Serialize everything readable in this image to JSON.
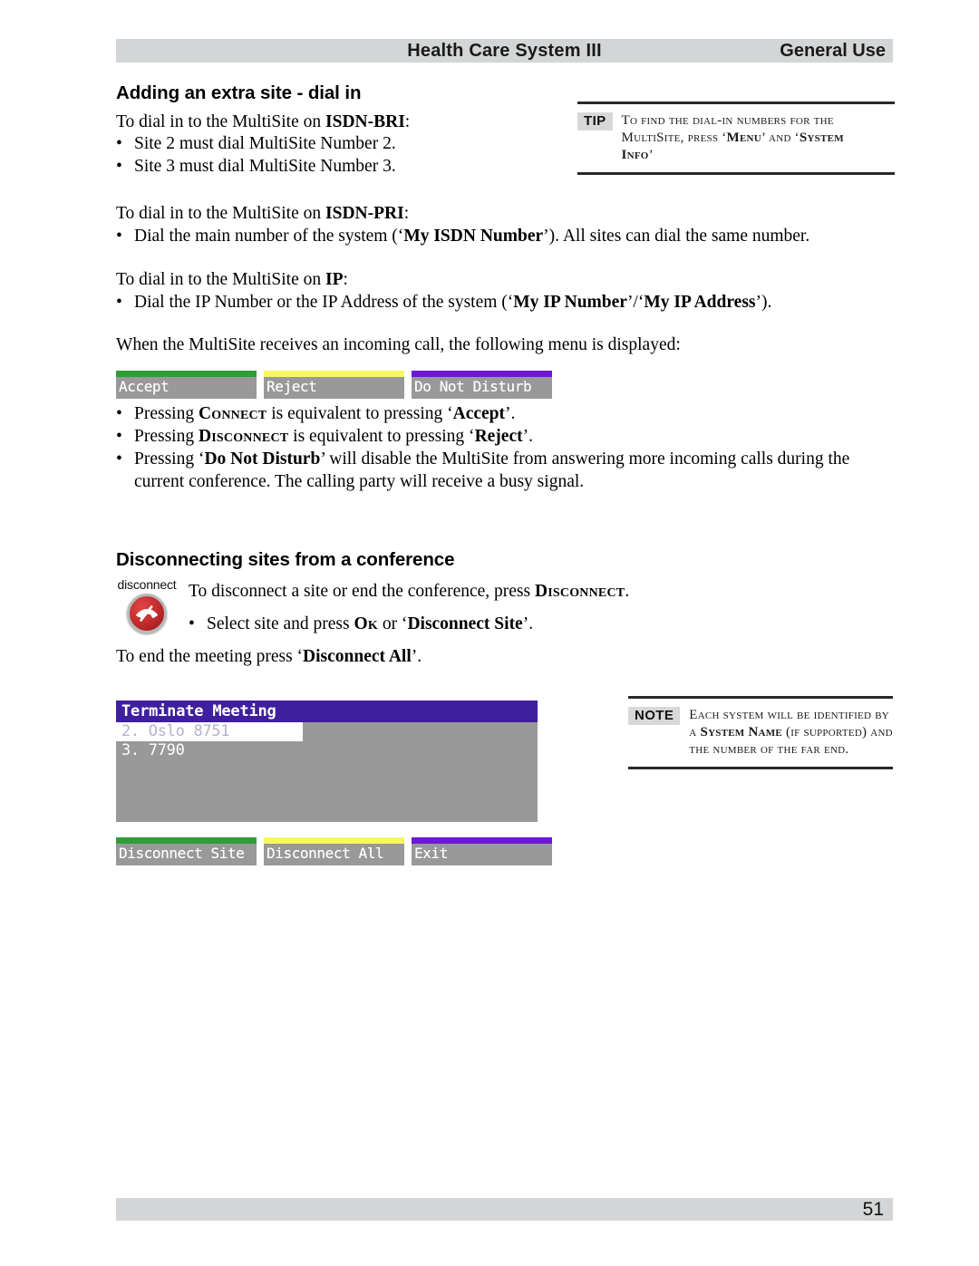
{
  "header": {
    "title": "Health Care System III",
    "section": "General Use"
  },
  "footer": {
    "page_number": "51"
  },
  "sections": {
    "adding": {
      "heading": "Adding an extra site - dial in",
      "bri_intro_prefix": "To dial in to the MultiSite on ",
      "bri_intro_bold": "ISDN-BRI",
      "bri_intro_suffix": ":",
      "bri_bullet_1": "Site 2 must dial MultiSite Number 2.",
      "bri_bullet_2": "Site 3 must dial MultiSite Number 3.",
      "pri_intro_prefix": "To dial in to the MultiSite on ",
      "pri_intro_bold": "ISDN-PRI",
      "pri_intro_suffix": ":",
      "pri_bullet_prefix": "Dial the main number of the system (‘",
      "pri_bullet_bold": "My ISDN Number",
      "pri_bullet_suffix": "’). All sites can dial the same number.",
      "ip_intro_prefix": "To dial in to the MultiSite on ",
      "ip_intro_bold": "IP",
      "ip_intro_suffix": ":",
      "ip_bullet_prefix": "Dial the IP Number or the IP Address of the system (‘",
      "ip_bullet_bold_1": "My IP Number",
      "ip_bullet_mid": "’/‘",
      "ip_bullet_bold_2": "My IP Address",
      "ip_bullet_suffix": "’).",
      "incoming_intro": "When the MultiSite receives an incoming call, the following menu is displayed:",
      "after_menu_bullet_1_prefix": "Pressing ",
      "after_menu_bullet_1_sc": "Connect",
      "after_menu_bullet_1_mid": " is equivalent to pressing ‘",
      "after_menu_bullet_1_bold": "Accept",
      "after_menu_bullet_1_suffix": "’.",
      "after_menu_bullet_2_prefix": "Pressing ",
      "after_menu_bullet_2_sc": "Disconnect",
      "after_menu_bullet_2_mid": " is equivalent to pressing ‘",
      "after_menu_bullet_2_bold": "Reject",
      "after_menu_bullet_2_suffix": "’.",
      "after_menu_bullet_3_prefix": "Pressing ‘",
      "after_menu_bullet_3_bold": "Do Not Disturb",
      "after_menu_bullet_3_suffix": "’ will disable the MultiSite from answering more incoming calls during the current conference. The calling party will receive a busy signal."
    },
    "disconnecting": {
      "heading": "Disconnecting sites from a conference",
      "intro_prefix": "To disconnect a site or end the conference, press ",
      "intro_sc": "Disconnect",
      "intro_suffix": ".",
      "bullet_prefix": "Select site and press ",
      "bullet_sc": "Ok",
      "bullet_mid": " or ‘",
      "bullet_bold": "Disconnect Site",
      "bullet_suffix": "’.",
      "outro_prefix": "To end the meeting press ‘",
      "outro_bold": "Disconnect All",
      "outro_suffix": "’.",
      "key_label": "disconnect",
      "key_icon": "phone-hangup-icon"
    }
  },
  "callouts": {
    "tip": {
      "badge": "TIP",
      "text_prefix": "To find the dial-in numbers for the MultiSite, press ‘",
      "text_bold_1": "Menu",
      "text_mid": "’ and ‘",
      "text_bold_2": "System Info",
      "text_suffix": "’"
    },
    "note": {
      "badge": "NOTE",
      "text_prefix": "Each system will be identified by a ",
      "text_bold": "System Name",
      "text_suffix": " (if supported) and the number of the far end."
    }
  },
  "device_ui": {
    "incoming_softkeys": [
      {
        "label": "Accept",
        "color": "#2e9e35"
      },
      {
        "label": "Reject",
        "color": "#f7f763"
      },
      {
        "label": "Do Not Disturb",
        "color": "#6f17d6"
      }
    ],
    "terminate_screen": {
      "title": "Terminate Meeting",
      "title_color": "#3f1f9e",
      "background": "#999999",
      "items": [
        {
          "text": "2. Oslo 8751",
          "selected": true
        },
        {
          "text": "3. 7790",
          "selected": false
        }
      ]
    },
    "terminate_softkeys": [
      {
        "label": "Disconnect Site",
        "color": "#2e9e35"
      },
      {
        "label": "Disconnect All",
        "color": "#f7f763"
      },
      {
        "label": "Exit",
        "color": "#6f17d6"
      }
    ]
  }
}
